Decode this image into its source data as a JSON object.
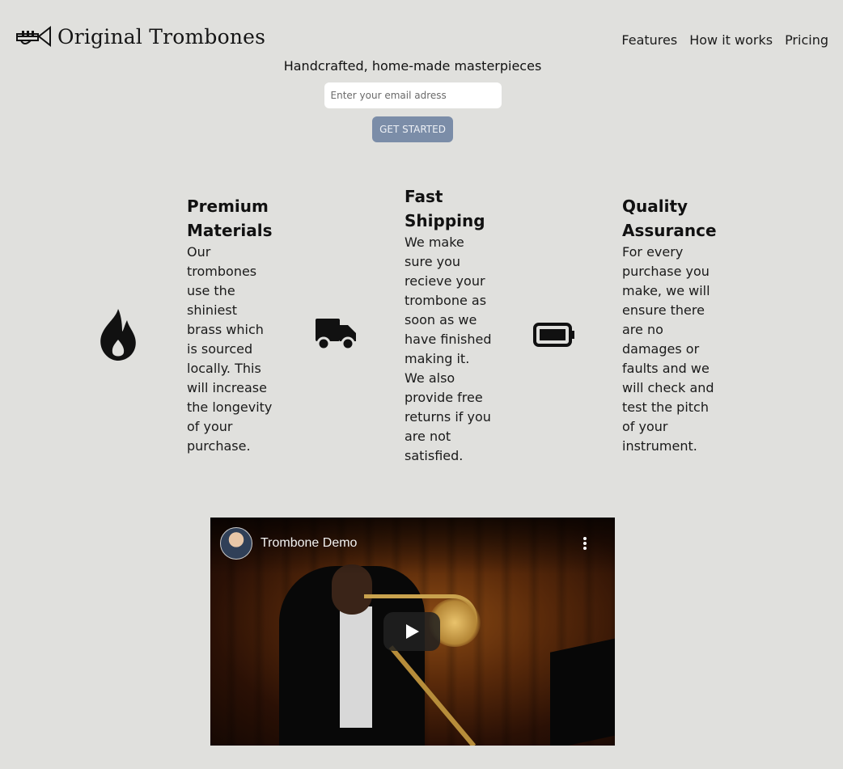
{
  "header": {
    "logo_text": "Original Trombones",
    "logo_icon": "trumpet-icon",
    "nav": [
      "Features",
      "How it works",
      "Pricing"
    ]
  },
  "hero": {
    "tagline": "Handcrafted, home-made masterpieces",
    "email_placeholder": "Enter your email adress",
    "cta_label": "GET STARTED"
  },
  "features": [
    {
      "icon": "fire-icon",
      "title": "Premium Materials",
      "text": "Our trombones use the shiniest brass which is sourced locally. This will increase the longevity of your purchase."
    },
    {
      "icon": "truck-icon",
      "title": "Fast Shipping",
      "text": "We make sure you recieve your trombone as soon as we have finished making it. We also provide free returns if you are not satisfied."
    },
    {
      "icon": "battery-full-icon",
      "title": "Quality Assurance",
      "text": "For every purchase you make, we will ensure there are no damages or faults and we will check and test the pitch of your instrument."
    }
  ],
  "video": {
    "title": "Trombone Demo"
  }
}
